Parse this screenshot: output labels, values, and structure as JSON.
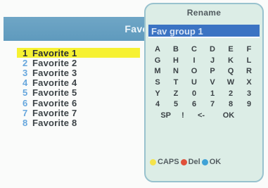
{
  "header": {
    "title": "Favor"
  },
  "favorites": [
    {
      "num": "1",
      "label": "Favorite 1",
      "selected": true
    },
    {
      "num": "2",
      "label": "Favorite 2",
      "selected": false
    },
    {
      "num": "3",
      "label": "Favorite 3",
      "selected": false
    },
    {
      "num": "4",
      "label": "Favorite 4",
      "selected": false
    },
    {
      "num": "5",
      "label": "Favorite 5",
      "selected": false
    },
    {
      "num": "6",
      "label": "Favorite 6",
      "selected": false
    },
    {
      "num": "7",
      "label": "Favorite 7",
      "selected": false
    },
    {
      "num": "8",
      "label": "Favorite 8",
      "selected": false
    }
  ],
  "rename_dialog": {
    "title": "Rename",
    "field_value": "Fav group 1",
    "keys": [
      [
        "A",
        "B",
        "C",
        "D",
        "E",
        "F"
      ],
      [
        "G",
        "H",
        "I",
        "J",
        "K",
        "L"
      ],
      [
        "M",
        "N",
        "O",
        "P",
        "Q",
        "R"
      ],
      [
        "S",
        "T",
        "U",
        "V",
        "W",
        "X"
      ],
      [
        "Y",
        "Z",
        "0",
        "1",
        "2",
        "3"
      ],
      [
        "4",
        "5",
        "6",
        "7",
        "8",
        "9"
      ]
    ],
    "special_keys": {
      "space": "SP",
      "bang": "!",
      "back": "<-",
      "ok": "OK"
    },
    "legend": {
      "caps": "CAPS",
      "del": "Del",
      "ok": "OK"
    }
  },
  "colors": {
    "header_bar": "#6fa6c6",
    "selected_row": "#f6f132",
    "name_field": "#3b73c3",
    "dialog_bg": "#dcede6",
    "caps_key": "#f4e34a",
    "del_key": "#e0503a",
    "ok_key": "#3fa2d6"
  }
}
